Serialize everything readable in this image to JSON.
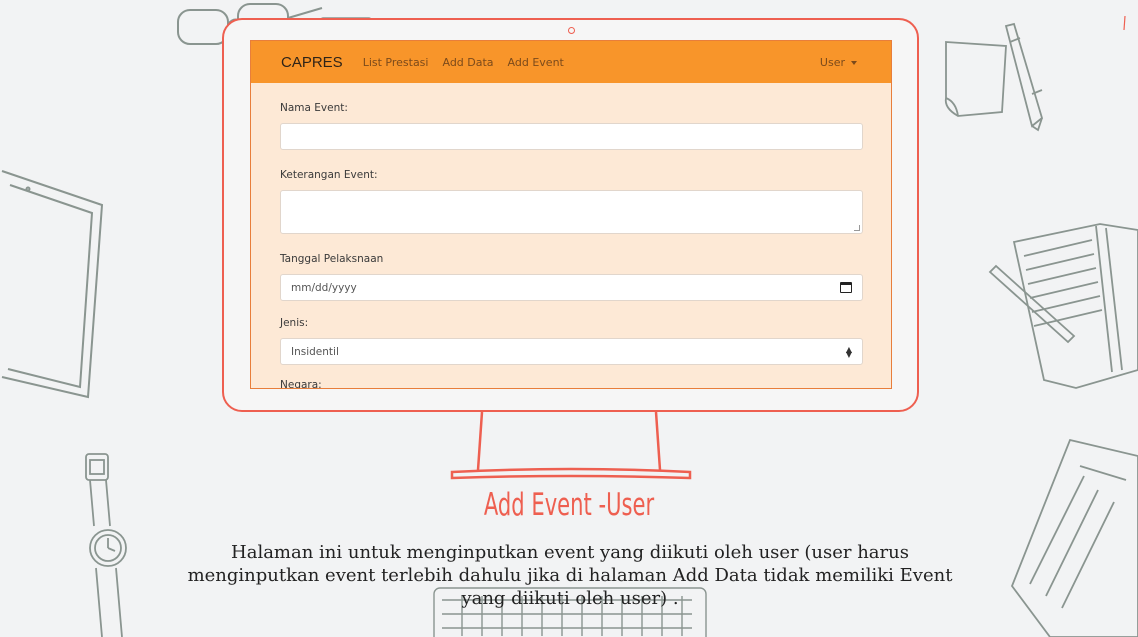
{
  "navbar": {
    "brand": "CAPRES",
    "links": [
      "List Prestasi",
      "Add Data",
      "Add Event"
    ],
    "user_label": "User"
  },
  "form": {
    "nama_event_label": "Nama Event:",
    "nama_event_value": "",
    "keterangan_label": "Keterangan Event:",
    "keterangan_value": "",
    "tanggal_label": "Tanggal Pelaksnaan",
    "tanggal_placeholder": "mm/dd/yyyy",
    "jenis_label": "Jenis:",
    "jenis_value": "Insidentil",
    "negara_label": "Negara:"
  },
  "caption": {
    "title": "Add Event -User",
    "description": "Halaman ini untuk menginputkan event yang diikuti oleh user (user harus menginputkan event terlebih dahulu jika di halaman Add Data tidak memiliki Event yang diikuti oleh user) ."
  },
  "colors": {
    "accent": "#ee5f50",
    "navbar": "#f8952a",
    "screen_bg": "#fde9d6",
    "sketch": "#8a9590"
  }
}
